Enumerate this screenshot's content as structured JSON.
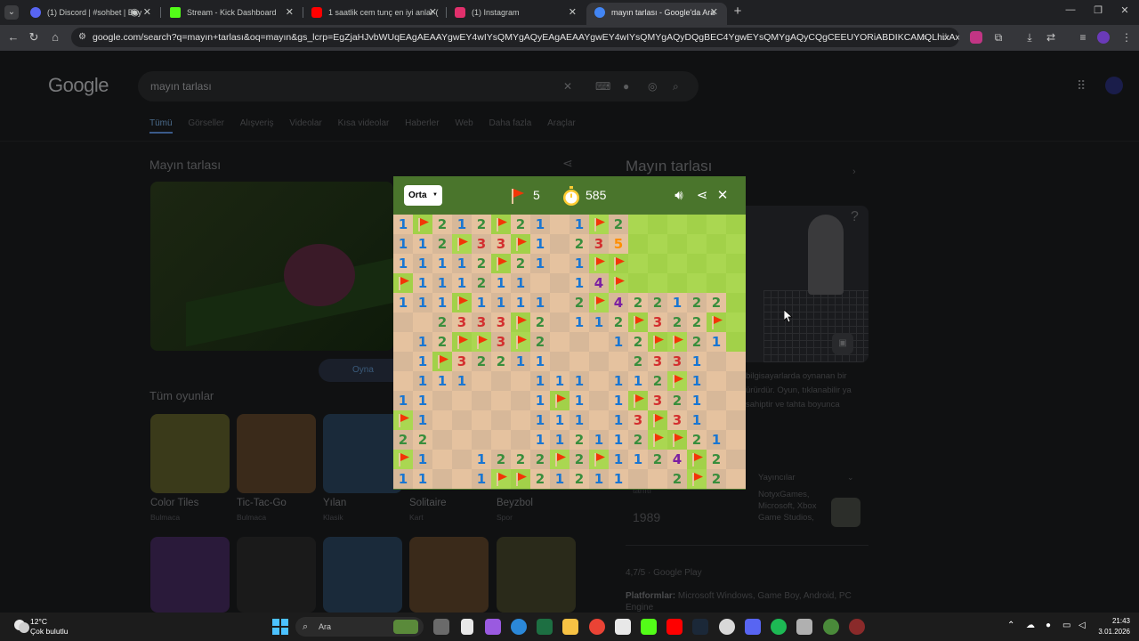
{
  "browser": {
    "tabs": [
      {
        "title": "(1) Discord | #sohbet | Bay",
        "icon_color": "#5865f2",
        "active": false
      },
      {
        "title": "Stream - Kick Dashboard",
        "icon_color": "#53fc18",
        "active": false
      },
      {
        "title": "1 saatlik cem tunç en iyi anlar (",
        "icon_color": "#ff0000",
        "active": false
      },
      {
        "title": "(1) Instagram",
        "icon_color": "#e1306c",
        "active": false
      },
      {
        "title": "mayın tarlası - Google'da Ara",
        "icon_color": "#4285f4",
        "active": true
      }
    ],
    "address": "google.com/search?q=mayın+tarlası&oq=mayın&gs_lcrp=EgZjaHJvbWUqEAgAEAAYgwEY4wIYsQMYgAQyEAgAEAAYgwEY4wIYsQMYgAQyDQgBEC4YgwEYsQMYgAQyCQgCEEUYORiABDIKCAMQLhixAxiABDIHCAQQABiABDIH..."
  },
  "google": {
    "logo": "Google",
    "query": "mayın tarlası",
    "filters": [
      "Tümü",
      "Görseller",
      "Alışveriş",
      "Videolar",
      "Kısa videolar",
      "Haberler",
      "Web",
      "Daha fazla",
      "Araçlar"
    ],
    "result_title": "Mayın tarlası",
    "play_label": "Oyna",
    "more_games_title": "Tüm oyunlar",
    "games": [
      {
        "name": "Color Tiles",
        "category": "Bulmaca",
        "color": "#3a3a1a"
      },
      {
        "name": "Tic-Tac-Go",
        "category": "Bulmaca",
        "color": "#3a2a1a"
      },
      {
        "name": "Yılan",
        "category": "Klasik",
        "color": "#1a2a3a"
      },
      {
        "name": "Solitaire",
        "category": "Kart",
        "color": "#1a2a1a"
      },
      {
        "name": "Beyzbol",
        "category": "Spor",
        "color": "#2a1a1a"
      }
    ],
    "games_row2_colors": [
      "#2a1a3a",
      "#1a1a1a",
      "#1a2a3a",
      "#3a2a1a",
      "#2a2a1a"
    ],
    "panel": {
      "title": "Mayın tarlası",
      "description": "bilgisayarlarda oynanan bir ürürdür. Oyun, tıklanabilir ya sahiptir ve tahta boyunca",
      "publishers_label": "Yayıncılar",
      "publishers": "NotyxGames, Microsoft, Xbox Game Studios,",
      "publishers_more": "+3",
      "intro_label": "tanıtı",
      "year": "1989",
      "rating": "4,7/5 · Google Play",
      "platform_label": "Platformlar:",
      "platforms": "Microsoft Windows, Game Boy, Android, PC Engine"
    }
  },
  "minesweeper": {
    "difficulty": "Orta",
    "flags_left": "5",
    "time": "585",
    "rows": [
      "1F21F21.1F2.....",
      "112F33F1.235....",
      "11112F21.1FF....",
      "F11121.1.14F....",
      "111F111.12F42212",
      "..2333F2.112F322F",
      ".12FF3F2...12FF21",
      ".1F3221....233 1",
      ".111...111.112F1.",
      "11....1F1.1F321.",
      "F1....111.13F31.",
      "22....11211 2FF21",
      "F1..1222F2F112 4F2",
      "11..1FF2121 1.2F2"
    ],
    "board_state": [
      "1F21F21_1F2UUUUU",
      "112F33F1_235UUUU",
      "11112F21_1FFUUUU",
      "F11121 1_14FUUUU",
      "111F111__2F42212",
      "__2333F2_112F322F",
      "_12FF3F2___12FF21",
      "_1F3221_____233 1",
      "_111___111_112F1_",
      "11____1F1_1F321_",
      "F1____111_13F31_",
      "22____11211_2FF21",
      "F1__1222F2F112 4F2",
      "11__1FF2121_1_2F2"
    ],
    "grid": [
      [
        "1",
        "F",
        "2",
        "1",
        "2",
        "F",
        "2",
        "1",
        "",
        "1",
        "F",
        "2",
        "U",
        "U",
        "U",
        "U",
        "U",
        "U"
      ],
      [
        "1",
        "1",
        "2",
        "F",
        "3",
        "3",
        "F",
        "1",
        "",
        "2",
        "3",
        "5",
        "U",
        "U",
        "U",
        "U",
        "U",
        "U"
      ],
      [
        "1",
        "1",
        "1",
        "1",
        "2",
        "F",
        "2",
        "1",
        "",
        "1",
        "F",
        "F",
        "U",
        "U",
        "U",
        "U",
        "U",
        "U"
      ],
      [
        "F",
        "1",
        "1",
        "1",
        "2",
        "1",
        "1",
        "",
        "",
        "1",
        "4",
        "F",
        "U",
        "U",
        "U",
        "U",
        "U",
        "U"
      ],
      [
        "1",
        "1",
        "1",
        "F",
        "1",
        "1",
        "1",
        "1",
        "",
        "2",
        "F",
        "4",
        "2",
        "2",
        "1",
        "2",
        "2",
        "U"
      ],
      [
        "",
        "",
        "2",
        "3",
        "3",
        "3",
        "F",
        "2",
        "",
        "1",
        "1",
        "2",
        "F",
        "3",
        "2",
        "2",
        "F",
        "U"
      ],
      [
        "",
        "1",
        "2",
        "F",
        "F",
        "3",
        "F",
        "2",
        "",
        "",
        "",
        "1",
        "2",
        "F",
        "F",
        "2",
        "1",
        "U"
      ],
      [
        "",
        "1",
        "F",
        "3",
        "2",
        "2",
        "1",
        "1",
        "",
        "",
        "",
        "",
        "2",
        "3",
        "3",
        "1",
        "",
        ""
      ],
      [
        "",
        "1",
        "1",
        "1",
        "",
        "",
        "",
        "1",
        "1",
        "1",
        "",
        "1",
        "1",
        "2",
        "F",
        "1",
        "",
        ""
      ],
      [
        "1",
        "1",
        "",
        "",
        "",
        "",
        "",
        "1",
        "F",
        "1",
        "",
        "1",
        "F",
        "3",
        "2",
        "1",
        "",
        ""
      ],
      [
        "F",
        "1",
        "",
        "",
        "",
        "",
        "",
        "1",
        "1",
        "1",
        "",
        "1",
        "3",
        "F",
        "3",
        "1",
        "",
        ""
      ],
      [
        "2",
        "2",
        "",
        "",
        "",
        "",
        "",
        "1",
        "1",
        "2",
        "1",
        "1",
        "2",
        "F",
        "F",
        "2",
        "1",
        ""
      ],
      [
        "F",
        "1",
        "",
        "",
        "1",
        "2",
        "2",
        "2",
        "F",
        "2",
        "F",
        "1",
        "1",
        "2",
        "4",
        "F",
        "2",
        ""
      ],
      [
        "1",
        "1",
        "",
        "",
        "1",
        "F",
        "F",
        "2",
        "1",
        "2",
        "1",
        "1",
        "",
        "",
        "2",
        "F",
        "2",
        ""
      ]
    ]
  },
  "taskbar": {
    "temperature": "12°C",
    "weather": "Çok bulutlu",
    "search_placeholder": "Ara",
    "time": "21:43",
    "date": "3.01.2026"
  }
}
